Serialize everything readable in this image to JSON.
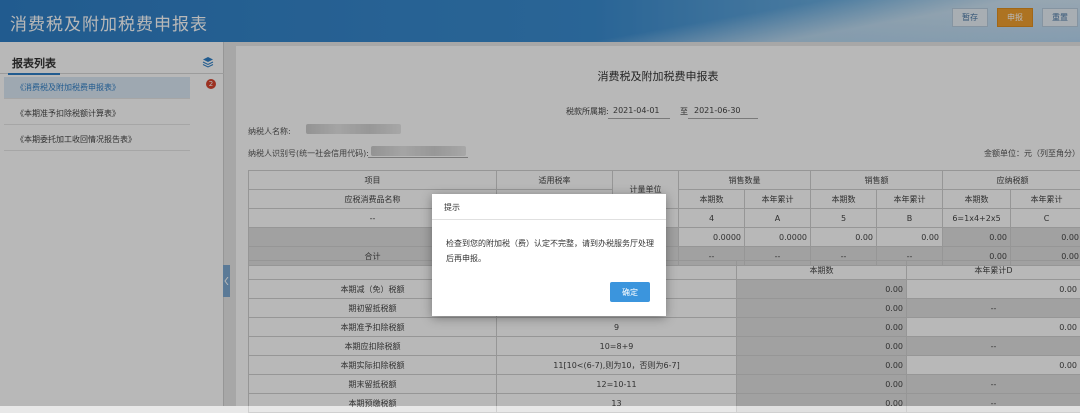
{
  "header": {
    "title": "消费税及附加税费申报表",
    "buttons": {
      "save": "暂存",
      "submit": "申报",
      "reset": "重置"
    }
  },
  "sidebar": {
    "title": "报表列表",
    "badge": "2",
    "items": [
      {
        "label": "《消费税及附加税费申报表》"
      },
      {
        "label": "《本期准予扣除税额计算表》"
      },
      {
        "label": "《本期委托加工收回情况报告表》"
      }
    ]
  },
  "form": {
    "title": "消费税及附加税费申报表",
    "period_label": "税款所属期:",
    "period_start": "2021-04-01",
    "period_to": "至",
    "period_end": "2021-06-30",
    "taxpayer_name_label": "纳税人名称:",
    "taxpayer_id_label": "纳税人识别号(统一社会信用代码):",
    "unit_label": "金额单位：元（列至角分）"
  },
  "table1": {
    "h_item": "项目",
    "h_rate": "适用税率",
    "h_unit": "计量单位",
    "h_qty": "销售数量",
    "h_amt": "销售额",
    "h_tax": "应纳税额",
    "h_name": "应税消费品名称",
    "h_cur": "本期数",
    "h_ytd": "本年累计",
    "codes": [
      "4",
      "A",
      "5",
      "B",
      "6=1x4+2x5",
      "C"
    ],
    "dash": "--",
    "row_vals": [
      "0.0000",
      "0.0000",
      "0.00",
      "0.00",
      "0.00",
      "0.00"
    ],
    "total_label": "合计",
    "total_vals": [
      "--",
      "--",
      "--",
      "--",
      "0.00",
      "0.00"
    ]
  },
  "table2": {
    "h_cur": "本期数",
    "h_ytd": "本年累计D",
    "rows": [
      {
        "label": "本期减（免）税额",
        "formula": "",
        "cur": "0.00",
        "ytd": "0.00"
      },
      {
        "label": "期初留抵税额",
        "formula": "",
        "cur": "0.00",
        "ytd": "--"
      },
      {
        "label": "本期准予扣除税额",
        "formula": "9",
        "cur": "0.00",
        "ytd": "0.00"
      },
      {
        "label": "本期应扣除税额",
        "formula": "10=8+9",
        "cur": "0.00",
        "ytd": "--"
      },
      {
        "label": "本期实际扣除税额",
        "formula": "11[10<(6-7),则为10，否则为6-7]",
        "cur": "0.00",
        "ytd": "0.00"
      },
      {
        "label": "期末留抵税额",
        "formula": "12=10-11",
        "cur": "0.00",
        "ytd": "--"
      },
      {
        "label": "本期预缴税额",
        "formula": "13",
        "cur": "0.00",
        "ytd": "--"
      }
    ]
  },
  "dialog": {
    "title": "提示",
    "message": "检查到您的附加税（费）认定不完整，请到办税服务厅处理后再申报。",
    "ok": "确定"
  },
  "colors": {
    "brand": "#2f7fc6",
    "submit": "#f0a030",
    "dialog_button": "#3b95dd",
    "badge": "#d9452f"
  }
}
